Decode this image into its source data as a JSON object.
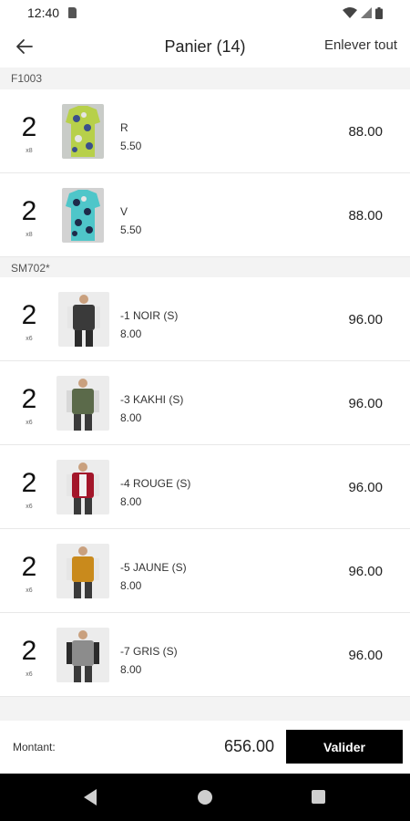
{
  "status": {
    "time": "12:40"
  },
  "header": {
    "title": "Panier (14)",
    "remove_all": "Enlever tout"
  },
  "groups": [
    {
      "label": "F1003",
      "items": [
        {
          "qty": "2",
          "sub": "x8",
          "name": "R",
          "unit_price": "5.50",
          "total": "88.00"
        },
        {
          "qty": "2",
          "sub": "x8",
          "name": "V",
          "unit_price": "5.50",
          "total": "88.00"
        }
      ]
    },
    {
      "label": "SM702*",
      "items": [
        {
          "qty": "2",
          "sub": "x6",
          "name": "-1 NOIR (S)",
          "unit_price": "8.00",
          "total": "96.00"
        },
        {
          "qty": "2",
          "sub": "x6",
          "name": "-3 KAKHI (S)",
          "unit_price": "8.00",
          "total": "96.00"
        },
        {
          "qty": "2",
          "sub": "x6",
          "name": "-4 ROUGE (S)",
          "unit_price": "8.00",
          "total": "96.00"
        },
        {
          "qty": "2",
          "sub": "x6",
          "name": "-5 JAUNE (S)",
          "unit_price": "8.00",
          "total": "96.00"
        },
        {
          "qty": "2",
          "sub": "x6",
          "name": "-7 GRIS (S)",
          "unit_price": "8.00",
          "total": "96.00"
        }
      ]
    }
  ],
  "footer": {
    "amount_label": "Montant:",
    "amount_value": "656.00",
    "validate_label": "Valider"
  },
  "colors": {
    "accent": "#000000",
    "section_bg": "#f3f3f3"
  }
}
